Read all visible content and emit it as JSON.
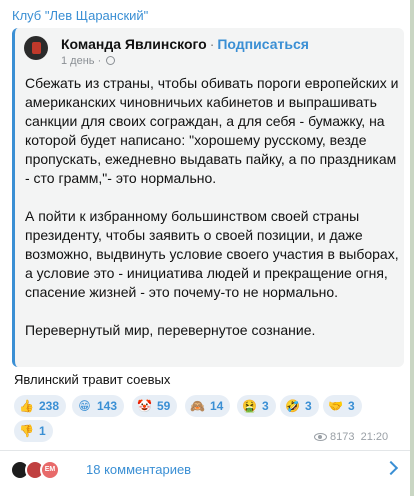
{
  "channel": {
    "title": "Клуб \"Лев Щаранский\""
  },
  "forward": {
    "source_name": "Команда Явлинского",
    "separator": "·",
    "subscribe_label": "Подписаться",
    "age": "1 день ·",
    "globe_icon": "globe-icon"
  },
  "post": {
    "paragraphs": [
      "Сбежать из страны, чтобы обивать пороги европейских и американских чиновничьих кабинетов и выпрашивать санкции для своих сограждан, а для себя - бумажку, на которой будет написано: \"хорошему русскому, везде пропускать, ежедневно выдавать пайку, а по праздникам - сто грамм,\"- это нормально.",
      "А пойти к избранному большинством своей страны президенту, чтобы заявить о своей позиции, и даже возможно, выдвинуть условие своего участия в выборах, а условие это - инициатива людей и прекращение огня, спасение жизней - это почему-то не нормально.",
      "Перевернутый мир, перевернутое сознание."
    ]
  },
  "caption": "Явлинский травит соевых",
  "reactions": [
    {
      "emoji": "👍",
      "count": "238"
    },
    {
      "emoji": "😁",
      "count": "143"
    },
    {
      "emoji": "🤡",
      "count": "59"
    },
    {
      "emoji": "🙈",
      "count": "14"
    },
    {
      "emoji": "🤮",
      "count": "3"
    },
    {
      "emoji": "🤣",
      "count": "3"
    },
    {
      "emoji": "🤝",
      "count": "3"
    },
    {
      "emoji": "👎",
      "count": "1"
    }
  ],
  "meta": {
    "views": "8173",
    "time": "21:20"
  },
  "comments": {
    "label": "18 комментариев",
    "avatars": [
      "",
      "",
      "EM"
    ]
  }
}
